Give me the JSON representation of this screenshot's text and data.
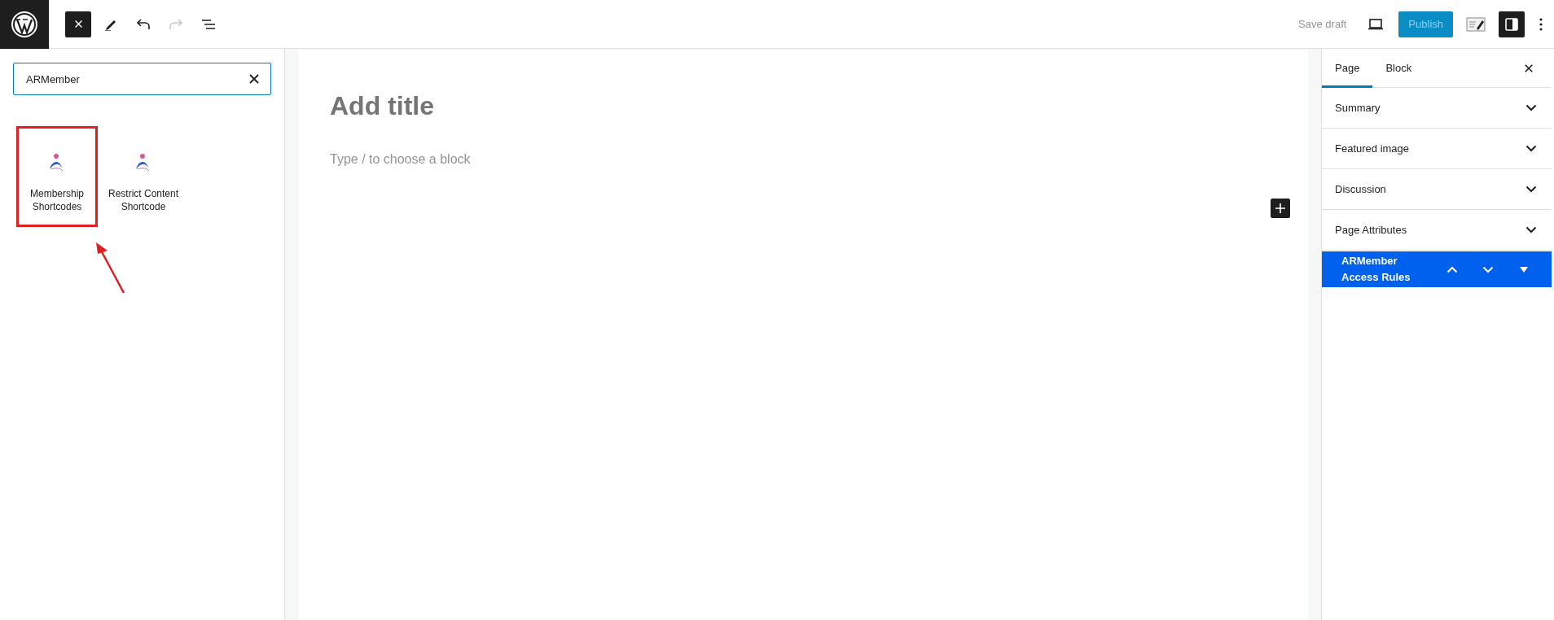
{
  "top_bar": {
    "inserter_open": true,
    "redo_disabled": true,
    "save_draft": "Save draft",
    "publish": {
      "label": "Publish",
      "disabled": true
    },
    "settings_open": true
  },
  "inserter": {
    "search": {
      "value": "ARMember"
    },
    "blocks": [
      {
        "label": "Membership Shortcodes",
        "highlighted": true
      },
      {
        "label": "Restrict Content Shortcode",
        "highlighted": false
      }
    ]
  },
  "editor": {
    "title_placeholder": "Add title",
    "block_placeholder": "Type / to choose a block"
  },
  "sidebar": {
    "tabs": [
      {
        "label": "Page",
        "selected": true
      },
      {
        "label": "Block",
        "selected": false
      }
    ],
    "panels": [
      {
        "title": "Summary",
        "expanded": false
      },
      {
        "title": "Featured image",
        "expanded": false
      },
      {
        "title": "Discussion",
        "expanded": false
      },
      {
        "title": "Page Attributes",
        "expanded": false
      }
    ],
    "meta_box": {
      "title": "ARMember Access Rules"
    }
  }
}
